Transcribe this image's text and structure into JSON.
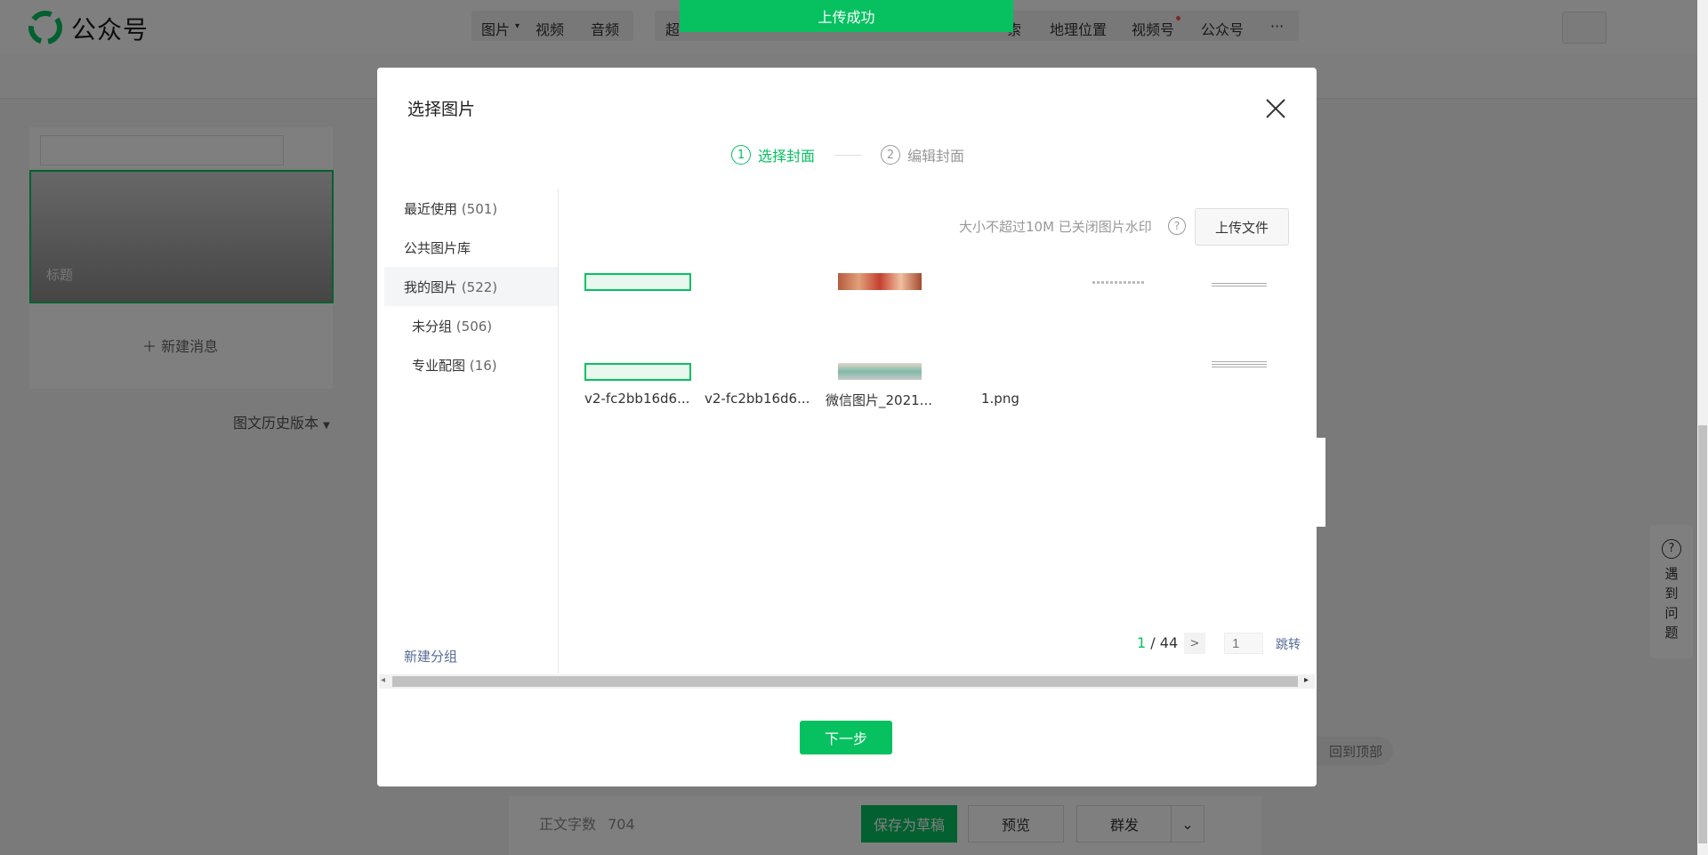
{
  "app": {
    "name": "公众号"
  },
  "toolbar": {
    "items": [
      "图片",
      "视频",
      "音频",
      "超",
      "索",
      "地理位置",
      "视频号",
      "公众号",
      "···"
    ]
  },
  "editor": {
    "cover_title_placeholder": "标题",
    "new_message": "新建消息",
    "history": "图文历史版本",
    "word_count_label": "正文字数",
    "word_count": "704",
    "save_draft": "保存为草稿",
    "preview": "预览",
    "publish": "群发",
    "back_to_top": "回到顶部",
    "help": "遇到问题"
  },
  "toast": {
    "text": "上传成功"
  },
  "dialog": {
    "title": "选择图片",
    "steps": [
      {
        "num": "1",
        "label": "选择封面"
      },
      {
        "num": "2",
        "label": "编辑封面"
      }
    ],
    "groups": [
      {
        "label": "最近使用",
        "count": "(501)"
      },
      {
        "label": "公共图片库",
        "count": ""
      },
      {
        "label": "我的图片",
        "count": "(522)"
      },
      {
        "label": "未分组",
        "count": "(506)"
      },
      {
        "label": "专业配图",
        "count": "(16)"
      }
    ],
    "new_group": "新建分组",
    "upload_hint": "大小不超过10M 已关闭图片水印",
    "upload_button": "上传文件",
    "images": [
      {
        "name": "v2-fc2bb16d6..."
      },
      {
        "name": "v2-fc2bb16d6..."
      },
      {
        "name": "微信图片_2021..."
      },
      {
        "name": "1.png"
      }
    ],
    "pager": {
      "current": "1",
      "total": "/ 44",
      "input_placeholder": "1",
      "jump": "跳转"
    },
    "next_button": "下一步"
  }
}
